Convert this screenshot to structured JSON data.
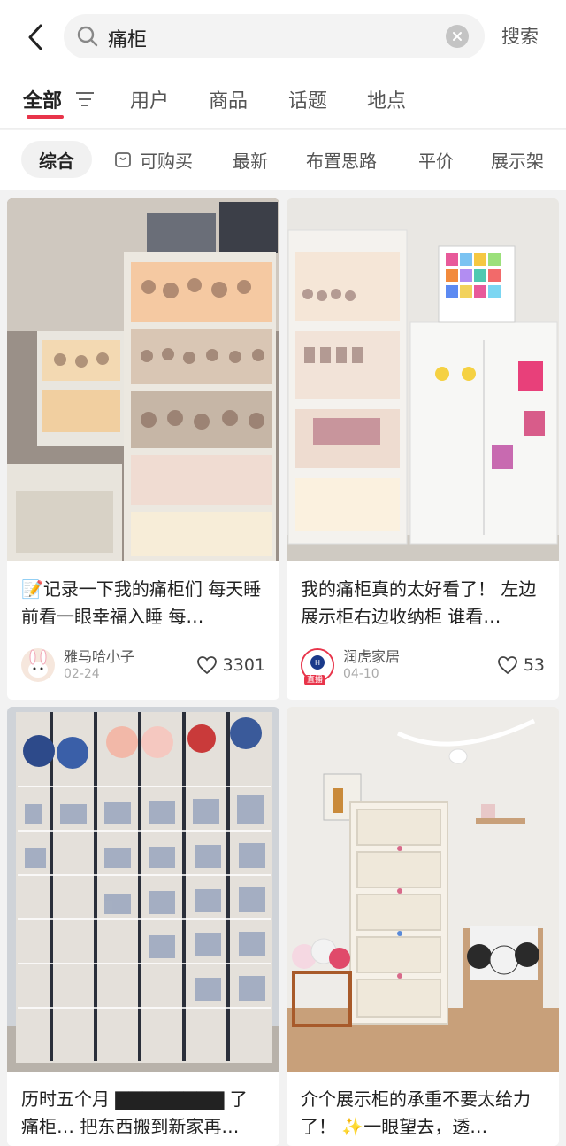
{
  "search": {
    "query": "痛柜",
    "button_label": "搜索"
  },
  "tabs": [
    {
      "label": "全部",
      "active": true
    },
    {
      "label": "用户"
    },
    {
      "label": "商品"
    },
    {
      "label": "话题"
    },
    {
      "label": "地点"
    }
  ],
  "chips": [
    {
      "label": "综合",
      "active": true
    },
    {
      "label": "可购买",
      "icon": "bag-icon"
    },
    {
      "label": "最新"
    },
    {
      "label": "布置思路"
    },
    {
      "label": "平价"
    },
    {
      "label": "展示架"
    }
  ],
  "posts": [
    {
      "title": "📝记录一下我的痛柜们 每天睡前看一眼幸福入睡 每…",
      "author": "雅马哈小子",
      "date": "02-24",
      "likes": "3301"
    },
    {
      "title": "我的痛柜真的太好看了！ 左边展示柜右边收纳柜 谁看…",
      "author": "润虎家居",
      "date": "04-10",
      "likes": "53",
      "avatar_text": "润虎家居",
      "live_badge": "直播"
    },
    {
      "title": "历时五个月 ▇▇▇▇▇▇▇▇ 了 痛柜… 把东西搬到新家再…"
    },
    {
      "title": "介个展示柜的承重不要太给力了！ ✨一眼望去，透…"
    }
  ]
}
